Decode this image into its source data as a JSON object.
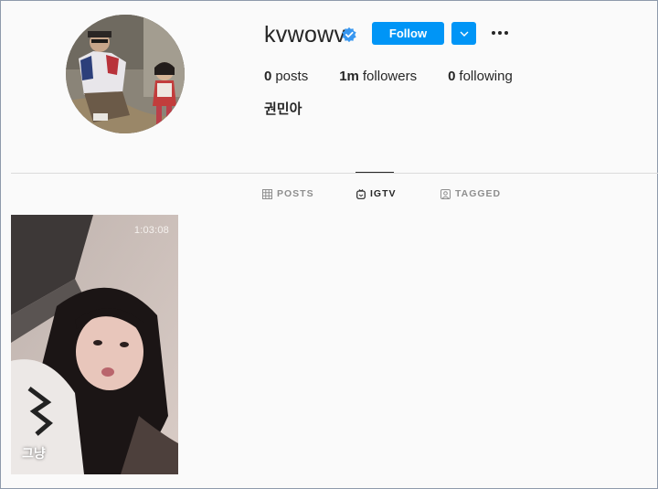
{
  "profile": {
    "username": "kvwowv",
    "verified_icon": "verified-badge-icon",
    "follow_label": "Follow",
    "dropdown_icon": "chevron-down-icon",
    "more_icon": "more-options-icon",
    "full_name": "권민아"
  },
  "stats": [
    {
      "count": "0",
      "label": "posts"
    },
    {
      "count": "1m",
      "label": "followers"
    },
    {
      "count": "0",
      "label": "following"
    }
  ],
  "tabs": [
    {
      "label": "POSTS",
      "icon": "grid-icon",
      "active": false
    },
    {
      "label": "IGTV",
      "icon": "igtv-icon",
      "active": true
    },
    {
      "label": "TAGGED",
      "icon": "tagged-icon",
      "active": false
    }
  ],
  "igtv": [
    {
      "duration": "1:03:08",
      "title": "그냥"
    }
  ],
  "colors": {
    "accent": "#0095f6",
    "background": "#fafafa",
    "text": "#262626",
    "muted": "#8e8e8e",
    "divider": "#dbdbdb"
  }
}
